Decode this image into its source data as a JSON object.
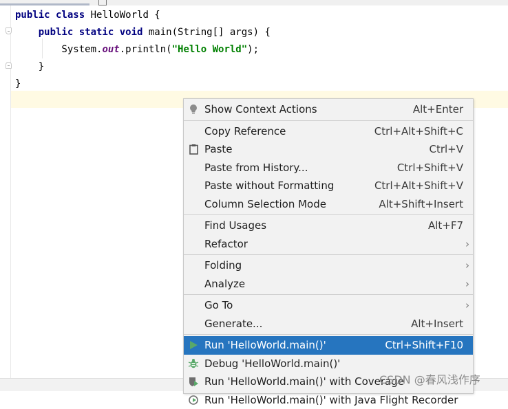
{
  "editor": {
    "lines": [
      {
        "parts": [
          {
            "t": "public class",
            "c": "kw"
          },
          {
            "t": " HelloWorld {",
            "c": ""
          }
        ]
      },
      {
        "parts": [
          {
            "t": "    ",
            "c": ""
          },
          {
            "t": "public static void",
            "c": "kw"
          },
          {
            "t": " main(String[] args) {",
            "c": ""
          }
        ]
      },
      {
        "parts": [
          {
            "t": "        System.",
            "c": ""
          },
          {
            "t": "out",
            "c": "field"
          },
          {
            "t": ".println(",
            "c": ""
          },
          {
            "t": "\"Hello World\"",
            "c": "str"
          },
          {
            "t": ");",
            "c": ""
          }
        ]
      },
      {
        "parts": [
          {
            "t": "    }",
            "c": ""
          }
        ]
      },
      {
        "parts": [
          {
            "t": "}",
            "c": ""
          }
        ]
      }
    ]
  },
  "menu": {
    "show_context_actions": {
      "label": "Show Context Actions",
      "shortcut": "Alt+Enter"
    },
    "copy_reference": {
      "label": "Copy Reference",
      "shortcut": "Ctrl+Alt+Shift+C"
    },
    "paste": {
      "label": "Paste",
      "shortcut": "Ctrl+V"
    },
    "paste_from_history": {
      "label": "Paste from History...",
      "shortcut": "Ctrl+Shift+V"
    },
    "paste_without_formatting": {
      "label": "Paste without Formatting",
      "shortcut": "Ctrl+Alt+Shift+V"
    },
    "column_selection_mode": {
      "label": "Column Selection Mode",
      "shortcut": "Alt+Shift+Insert"
    },
    "find_usages": {
      "label": "Find Usages",
      "shortcut": "Alt+F7"
    },
    "refactor": {
      "label": "Refactor"
    },
    "folding": {
      "label": "Folding"
    },
    "analyze": {
      "label": "Analyze"
    },
    "go_to": {
      "label": "Go To"
    },
    "generate": {
      "label": "Generate...",
      "shortcut": "Alt+Insert"
    },
    "run": {
      "label": "Run 'HelloWorld.main()'",
      "shortcut": "Ctrl+Shift+F10"
    },
    "debug": {
      "label": "Debug 'HelloWorld.main()'"
    },
    "run_coverage": {
      "label": "Run 'HelloWorld.main()' with Coverage"
    },
    "run_flight": {
      "label": "Run 'HelloWorld.main()' with Java Flight Recorder"
    }
  },
  "watermark": "CSDN @春风浅作序",
  "colors": {
    "selection": "#2675bf",
    "keyword": "#000080",
    "string": "#008000",
    "field": "#660e7a",
    "caret_line": "#fffae3"
  },
  "icons": {
    "show_context_actions": "lightbulb-icon",
    "paste": "clipboard-icon",
    "run": "run-triangle-icon",
    "debug": "bug-icon",
    "run_coverage": "coverage-shield-icon"
  }
}
